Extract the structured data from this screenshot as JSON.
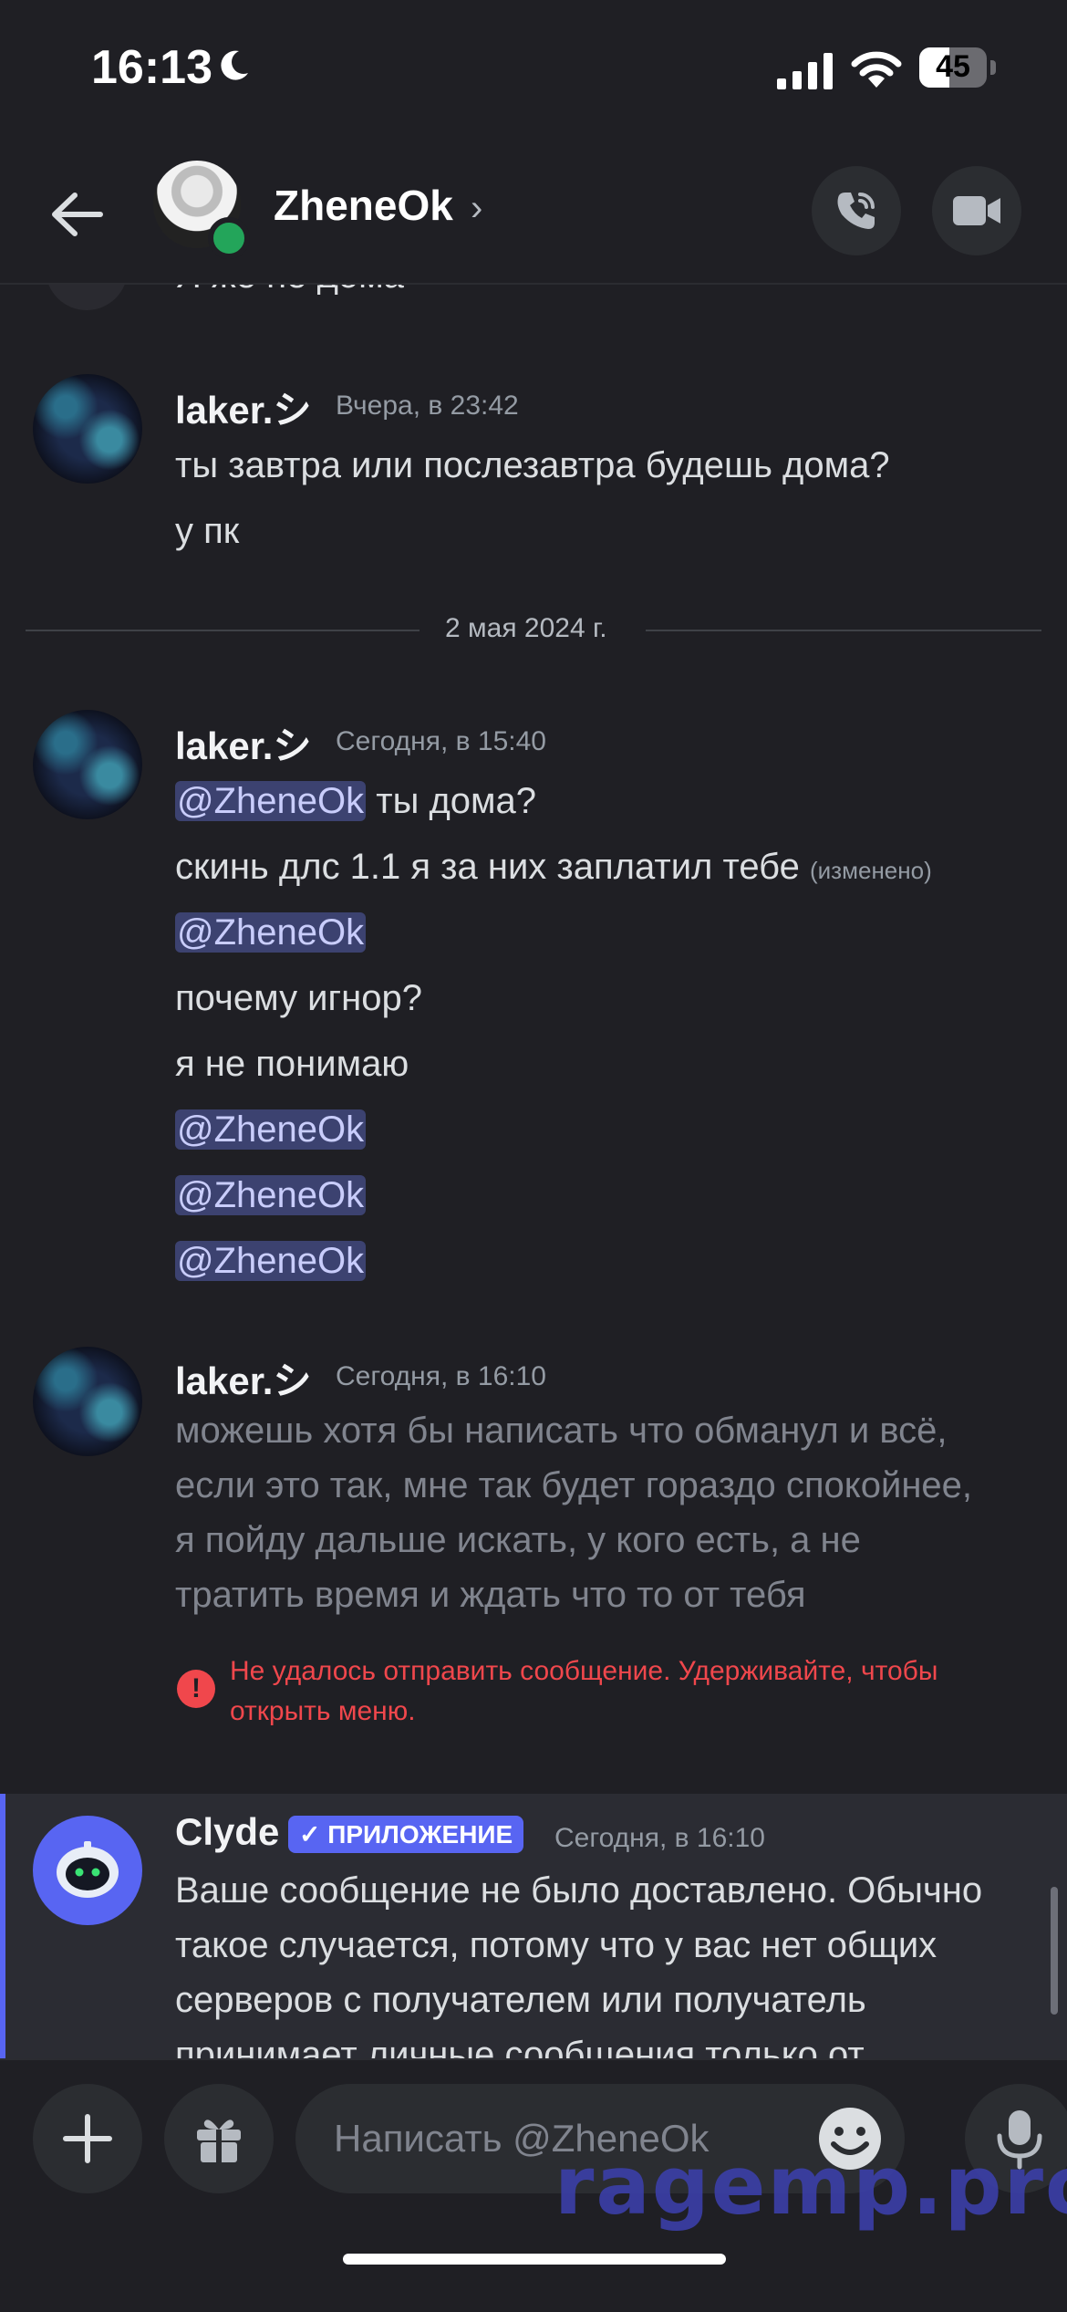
{
  "status_bar": {
    "time": "16:13",
    "battery": "45",
    "battery_level": 0.45
  },
  "header": {
    "contact_name": "ZheneOk",
    "chevron": "›"
  },
  "partial_message": "Я же не дома",
  "messages": [
    {
      "author": "laker.シ",
      "time": "Вчера, в 23:42",
      "lines": [
        "ты завтра или послезавтра будешь дома?",
        "у пк"
      ]
    },
    {
      "author": "laker.シ",
      "time": "Сегодня, в 15:40",
      "lines": [
        {
          "mention": "@ZheneOk",
          "text": " ты дома?"
        },
        {
          "text": "скинь длс 1.1 я за них заплатил тебе",
          "edited": "(изменено)"
        },
        {
          "mention": "@ZheneOk"
        },
        {
          "text": "почему игнор?"
        },
        {
          "text": "я не понимаю"
        },
        {
          "mention": "@ZheneOk"
        },
        {
          "mention": "@ZheneOk"
        },
        {
          "mention": "@ZheneOk"
        }
      ]
    },
    {
      "author": "laker.シ",
      "time": "Сегодня, в 16:10",
      "lines": [
        "можешь хотя бы написать что обманул и всё,",
        "если это так, мне так будет гораздо спокойнее,",
        "я пойду дальше искать, у кого есть, а не",
        "тратить время и ждать что то от тебя"
      ],
      "error": [
        "Не удалось отправить сообщение. Удерживайте, чтобы",
        "открыть меню."
      ]
    }
  ],
  "date_divider": "2 мая 2024 г.",
  "clyde": {
    "author": "Clyde",
    "badge": "ПРИЛОЖЕНИЕ",
    "time": "Сегодня, в 16:10",
    "lines": [
      "Ваше сообщение не было доставлено. Обычно",
      "такое случается, потому что у вас нет общих",
      "серверов с получателем или получатель",
      "принимает личные сообщения только от"
    ]
  },
  "input": {
    "placeholder": "Написать @ZheneOk"
  },
  "watermark": "ragemp.pro",
  "colors": {
    "accent": "#5865f2",
    "error": "#f0474c",
    "online": "#23a55a",
    "mention_bg": "#3c4270"
  }
}
